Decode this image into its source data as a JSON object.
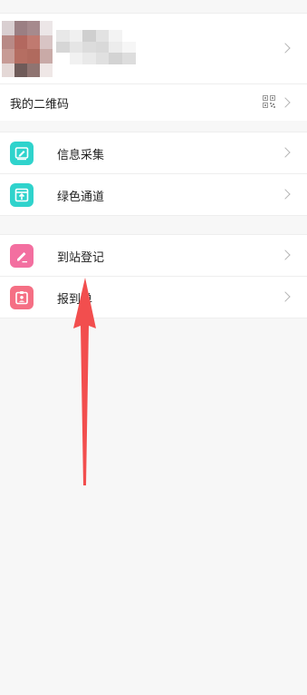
{
  "qr_row": {
    "label": "我的二维码"
  },
  "groups": [
    {
      "items": [
        {
          "label": "信息采集",
          "icon": "edit-form-icon",
          "color": "#2fd3cc"
        },
        {
          "label": "绿色通道",
          "icon": "green-channel-icon",
          "color": "#2fd3cc"
        }
      ]
    },
    {
      "items": [
        {
          "label": "到站登记",
          "icon": "pencil-icon",
          "color": "#f36fa0"
        },
        {
          "label": "报到单",
          "icon": "badge-icon",
          "color": "#f56f84"
        }
      ]
    }
  ],
  "colors": {
    "background": "#f7f7f7",
    "annotation_arrow": "#f24e4e"
  }
}
